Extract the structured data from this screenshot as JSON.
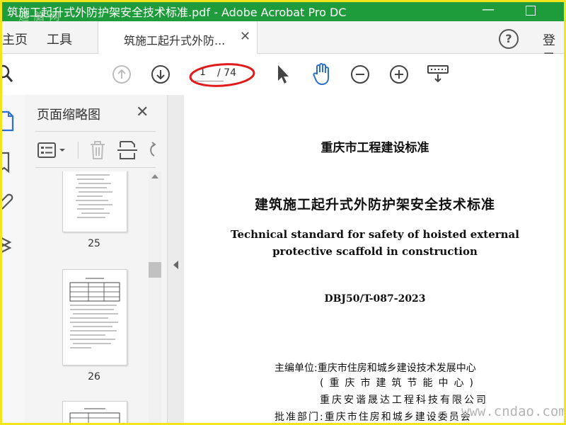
{
  "window": {
    "title": "筑施工起升式外防护架安全技术标准.pdf - Adobe Acrobat Pro DC",
    "watermark": "迪 脑 网",
    "minimize": "—"
  },
  "menu": {
    "home": "主页",
    "tools": "工具",
    "doc_tab": "筑施工起升式外防...",
    "doc_tab_close": "✕",
    "help": "?",
    "login": "登录"
  },
  "toolbar": {
    "page_current": "1",
    "page_total": "/ 74",
    "icons": [
      "search-icon",
      "page-up-icon",
      "page-down-icon",
      "select-cursor-icon",
      "hand-tool-icon",
      "zoom-out-icon",
      "zoom-in-icon",
      "keyboard-icon"
    ]
  },
  "panel": {
    "title": "页面缩略图",
    "close": "✕",
    "thumbs": [
      {
        "label": "25"
      },
      {
        "label": "26"
      },
      {
        "label": ""
      }
    ]
  },
  "document": {
    "org": "重庆市工程建设标准",
    "title": "建筑施工起升式外防护架安全技术标准",
    "english_line1": "Technical standard for safety of hoisted external",
    "english_line2": "protective scaffold in construction",
    "code": "DBJ50/T-087-2023",
    "line1": "主编单位:重庆市住房和城乡建设技术发展中心",
    "line2": "(重庆市建筑节能中心)",
    "line3": "重庆安谐晟达工程科技有限公司",
    "line4": "批准部门:重庆市住房和城乡建设委员会"
  },
  "watermark_bottom": "www.cndao.com",
  "colors": {
    "titlebar": "#1e9b3a",
    "frame": "#f2e51c",
    "accent_blue": "#2d6fcf",
    "annotation_red": "#e01b1b"
  }
}
